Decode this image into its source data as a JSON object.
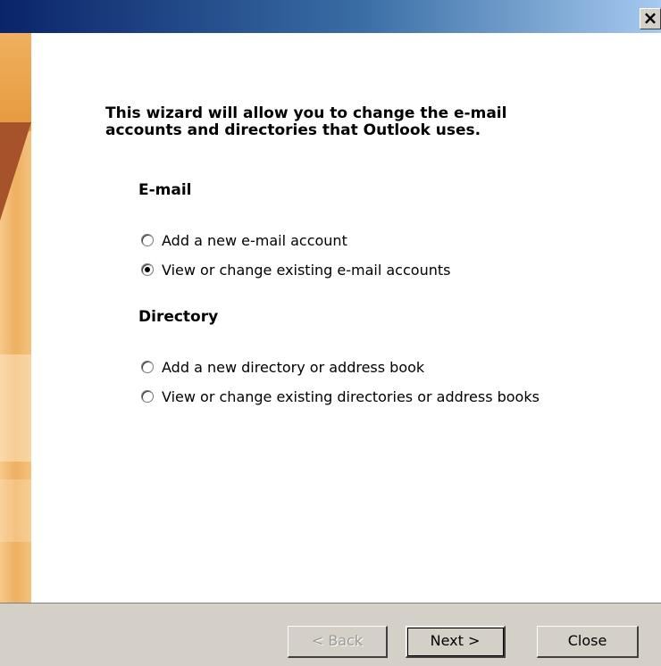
{
  "window": {
    "close_glyph": "×"
  },
  "wizard": {
    "intro_line1": "This wizard will allow you to change the e-mail",
    "intro_line2": "accounts and directories that Outlook uses.",
    "email": {
      "title": "E-mail",
      "options": [
        {
          "label": "Add a new e-mail account",
          "selected": false
        },
        {
          "label": "View or change existing e-mail accounts",
          "selected": true
        }
      ]
    },
    "directory": {
      "title": "Directory",
      "options": [
        {
          "label": "Add a new directory or address book",
          "selected": false
        },
        {
          "label": "View or change existing directories or address books",
          "selected": false
        }
      ]
    }
  },
  "buttons": {
    "back": "< Back",
    "next": "Next >",
    "close": "Close"
  },
  "colors": {
    "titlebar_start": "#0a246a",
    "titlebar_end": "#a6caf0",
    "side_band": "#efb062",
    "dialog_face": "#d4d0c8"
  }
}
